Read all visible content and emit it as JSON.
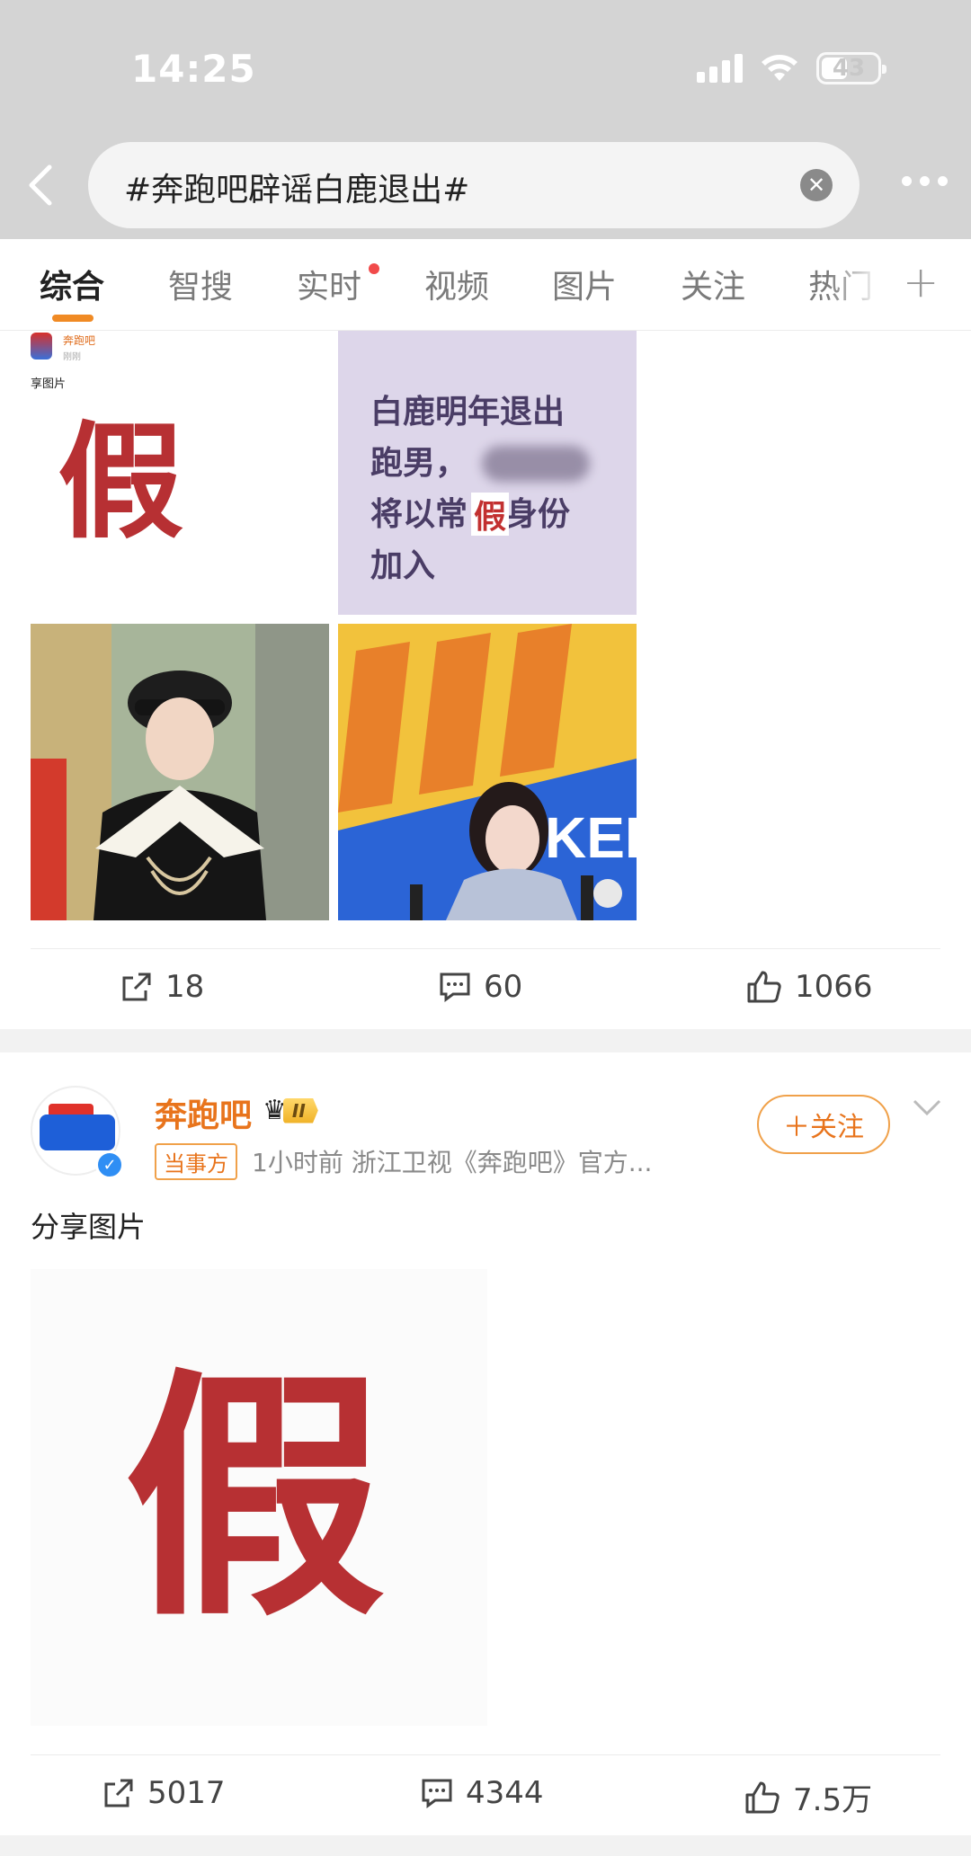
{
  "status_bar": {
    "time": "14:25",
    "battery": "43"
  },
  "search": {
    "query": "#奔跑吧辟谣白鹿退出#",
    "clear_icon": "close-circle-icon",
    "more_icon": "more-dots-icon",
    "back_icon": "chevron-left-icon"
  },
  "tabs": [
    {
      "label": "综合",
      "active": true
    },
    {
      "label": "智搜"
    },
    {
      "label": "实时",
      "has_dot": true
    },
    {
      "label": "视频"
    },
    {
      "label": "图片"
    },
    {
      "label": "关注"
    },
    {
      "label": "热门"
    }
  ],
  "tabs_add": "+",
  "post1": {
    "thumb1": {
      "author": "奔跑吧",
      "time": "刚刚",
      "share_text": "享图片",
      "big_char": "假"
    },
    "thumb2": {
      "line1": "白鹿明年退出",
      "line2": "跑男，",
      "line3a": "将以常",
      "line3b": "身份",
      "line4": "加入",
      "stamp": "假"
    },
    "actions": {
      "repost": "18",
      "comment": "60",
      "like": "1066"
    }
  },
  "post2": {
    "author": "奔跑吧",
    "level": "II",
    "tag": "当事方",
    "meta": "1小时前  浙江卫视《奔跑吧》官方...",
    "follow_label": "＋关注",
    "text": "分享图片",
    "image_char": "假",
    "actions": {
      "repost": "5017",
      "comment": "4344",
      "like": "7.5万"
    }
  },
  "colors": {
    "accent": "#e8741c",
    "underline": "#f08a24",
    "red_char": "#b73033",
    "topbar": "#d4d4d4"
  }
}
